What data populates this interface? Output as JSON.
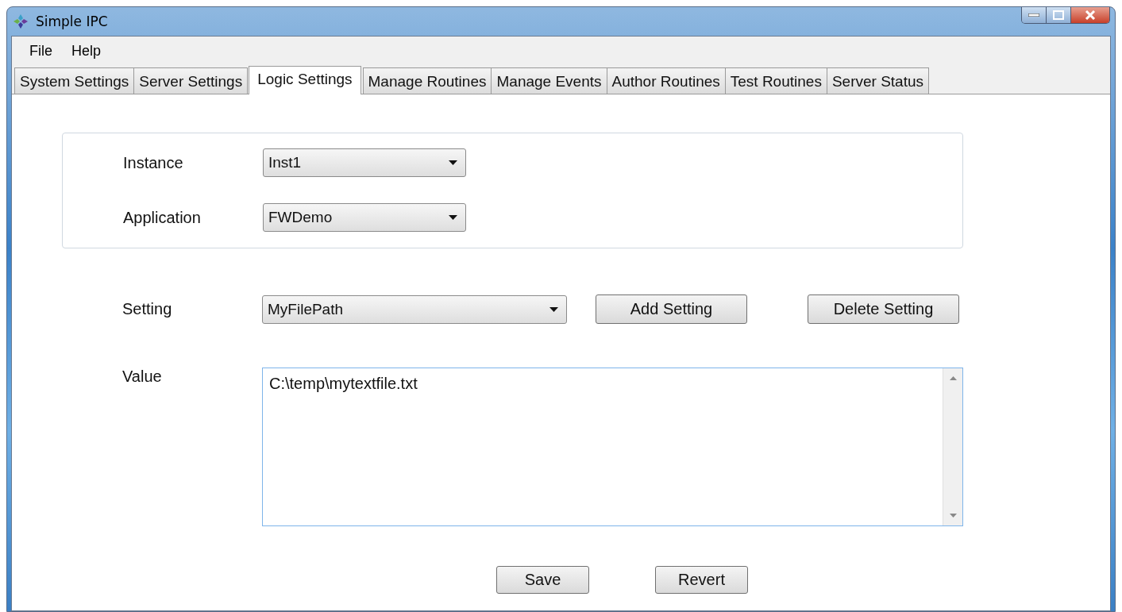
{
  "window": {
    "title": "Simple IPC"
  },
  "menu": [
    {
      "label": "File"
    },
    {
      "label": "Help"
    }
  ],
  "tabs": [
    {
      "label": "System Settings",
      "selected": false
    },
    {
      "label": "Server Settings",
      "selected": false
    },
    {
      "label": "Logic Settings",
      "selected": true
    },
    {
      "label": "Manage Routines",
      "selected": false
    },
    {
      "label": "Manage Events",
      "selected": false
    },
    {
      "label": "Author Routines",
      "selected": false
    },
    {
      "label": "Test Routines",
      "selected": false
    },
    {
      "label": "Server Status",
      "selected": false
    }
  ],
  "group": [
    {
      "label": "Instance",
      "value": "Inst1"
    },
    {
      "label": "Application",
      "value": "FWDemo"
    }
  ],
  "setting": {
    "label": "Setting",
    "value": "MyFilePath",
    "buttons": [
      "Add Setting",
      "Delete Setting"
    ]
  },
  "value": {
    "label": "Value",
    "text": "C:\\temp\\mytextfile.txt"
  },
  "actions": [
    "Save",
    "Revert"
  ]
}
